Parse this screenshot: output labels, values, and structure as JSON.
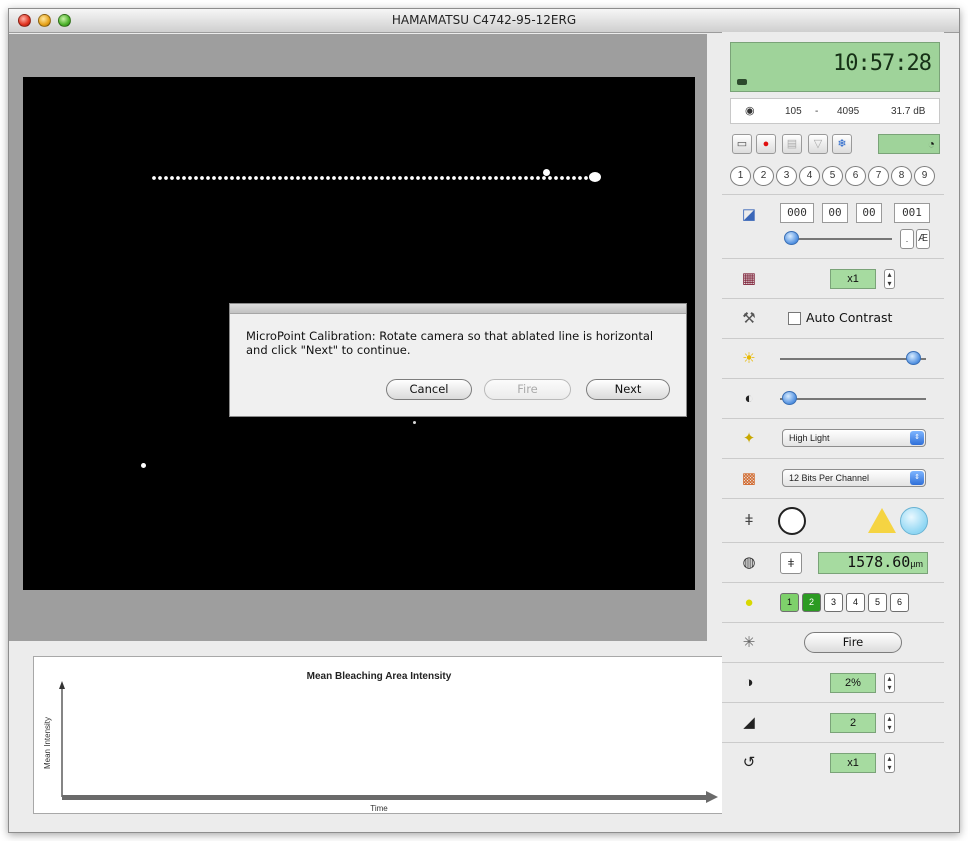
{
  "window": {
    "title": "HAMAMATSU C4742-95-12ERG"
  },
  "dialog": {
    "message": "MicroPoint Calibration: Rotate camera so that ablated line is horizontal and click \"Next\" to continue.",
    "cancel_label": "Cancel",
    "fire_label": "Fire",
    "next_label": "Next"
  },
  "graph": {
    "title": "Mean Bleaching Area Intensity",
    "xlabel": "Time",
    "ylabel": "Mean Intensity"
  },
  "panel": {
    "clock": "10:57:28",
    "range_min": "105",
    "range_sep": "-",
    "range_max": "4095",
    "range_db": "31.7 dB",
    "channels": [
      "1",
      "2",
      "3",
      "4",
      "5",
      "6",
      "7",
      "8",
      "9"
    ],
    "time_hours": "000",
    "time_minutes": "00",
    "time_seconds": "00",
    "time_ms": "001",
    "binning_value": "x1",
    "auto_contrast_label": "Auto Contrast",
    "auto_contrast_checked": false,
    "light_mode": "High Light",
    "bit_depth": "12 Bits Per Channel",
    "distance_value": "1578.60",
    "distance_unit": "µm",
    "laser_channels": [
      "1",
      "2",
      "3",
      "4",
      "5",
      "6"
    ],
    "fire_label": "Fire",
    "attenuation_value": "2%",
    "pulses_value": "2",
    "repeat_value": "x1"
  },
  "colors": {
    "lcd_green": "#9fd39a",
    "field_green": "#a6dba0",
    "image_background": "#000000"
  },
  "icons": [
    "close-window-icon",
    "minimize-window-icon",
    "zoom-window-icon",
    "battery-icon",
    "aperture-icon",
    "monitor-icon",
    "record-icon",
    "film-icon",
    "filter-icon",
    "snowflake-icon",
    "grid-icon",
    "lens-icon",
    "checkerboard-icon",
    "wrench-icon",
    "brightness-icon",
    "contrast-icon",
    "light-bulb-icon",
    "color-depth-icon",
    "marker-icon",
    "circle-icon",
    "warning-icon",
    "ruler-icon",
    "laser-icon",
    "burst-icon",
    "attenuator-icon",
    "ramp-icon",
    "repeat-icon"
  ]
}
